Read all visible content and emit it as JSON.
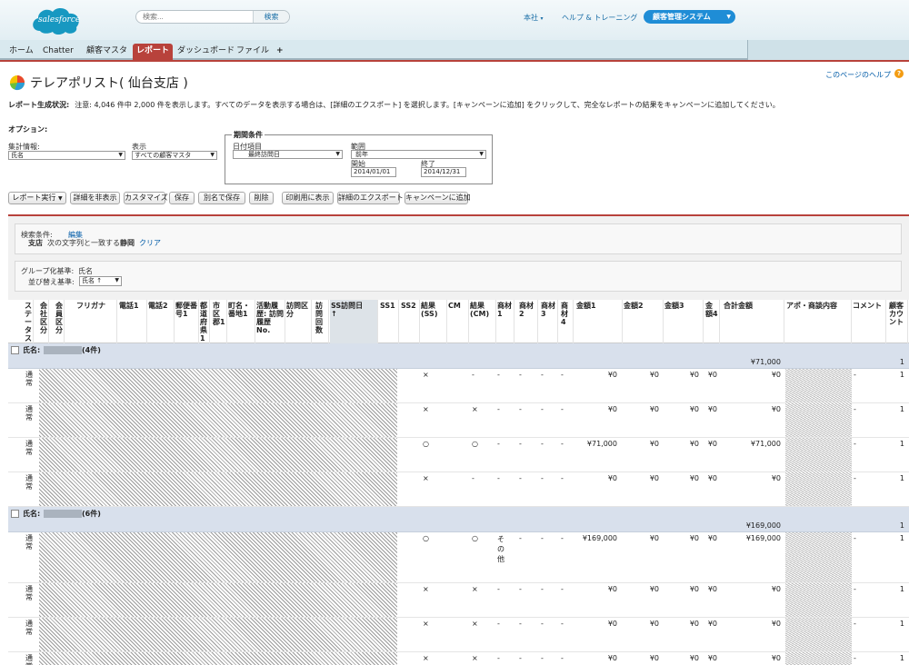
{
  "header": {
    "logo_text": "salesforce",
    "search_placeholder": "検索...",
    "search_button": "検索",
    "links": [
      "本社",
      "ヘルプ & トレーニング"
    ],
    "app_menu": "顧客管理システム"
  },
  "tabs": [
    "ホーム",
    "Chatter",
    "顧客マスタ",
    "レポート",
    "ダッシュボード",
    "ファイル",
    "+"
  ],
  "active_tab": "レポート",
  "page": {
    "title": "テレアポリスト( 仙台支店 )",
    "help_link": "このページのヘルプ",
    "status_label": "レポート生成状況:",
    "status_text": "注意: 4,046 件中 2,000 件を表示します。すべてのデータを表示する場合は、[詳細のエクスポート] を選択します。[キャンペーンに追加] をクリックして、完全なレポートの結果をキャンペーンに追加してください。"
  },
  "options": {
    "label": "オプション:",
    "summary_label": "集計情報:",
    "summary_value": "氏名",
    "show_label": "表示",
    "show_value": "すべての顧客マスタ",
    "period_legend": "期間条件",
    "date_field_label": "日付項目",
    "date_field_value": "最終訪問日",
    "range_label": "範囲",
    "range_value": "前年",
    "start_label": "開始",
    "start_value": "2014/01/01",
    "end_label": "終了",
    "end_value": "2014/12/31"
  },
  "buttons": [
    "レポート実行",
    "詳細を非表示",
    "カスタマイズ",
    "保存",
    "別名で保存",
    "削除",
    "印刷用に表示",
    "詳細のエクスポート",
    "キャンペーンに追加"
  ],
  "filters": {
    "label": "検索条件:",
    "edit": "編集",
    "field": "支店",
    "operator": "次の文字列と一致する",
    "value": "静岡",
    "clear": "クリア"
  },
  "grouping": {
    "label": "グループ化基準:",
    "value": "氏名",
    "sort_label": "並び替え基準:",
    "sort_value": "氏名 ↑"
  },
  "columns": [
    "ステータス",
    "会社区分",
    "会員区分",
    "フリガナ",
    "電話1",
    "電話2",
    "郵便番号1",
    "都道府県1",
    "市区郡1",
    "町名・番地1",
    "活動履歴: 訪問履歴No.",
    "訪問区分",
    "訪問回数",
    "SS訪問日",
    "SS1",
    "SS2",
    "結果(SS)",
    "CM",
    "結果(CM)",
    "商材1",
    "商材2",
    "商材3",
    "商材4",
    "金額1",
    "金額2",
    "金額3",
    "金額4",
    "合計金額",
    "アポ・商談内容",
    "コメント",
    "顧客カウント"
  ],
  "groups": [
    {
      "label": "氏名:",
      "count": "(4件)",
      "total": "¥71,000",
      "customer_count": "1",
      "rows": [
        {
          "status": "通常",
          "ss": "×",
          "cm": "-",
          "m1": "-",
          "m2": "-",
          "m3": "-",
          "m4": "-",
          "a1": "¥0",
          "a2": "¥0",
          "a3": "¥0",
          "a4": "¥0",
          "total": "¥0",
          "comment": "-",
          "count": "1"
        },
        {
          "status": "通常",
          "ss": "×",
          "cm": "×",
          "m1": "-",
          "m2": "-",
          "m3": "-",
          "m4": "-",
          "a1": "¥0",
          "a2": "¥0",
          "a3": "¥0",
          "a4": "¥0",
          "total": "¥0",
          "comment": "-",
          "count": "1"
        },
        {
          "status": "通常",
          "ss": "○",
          "cm": "○",
          "m1": "-",
          "m2": "-",
          "m3": "-",
          "m4": "-",
          "a1": "¥71,000",
          "a2": "¥0",
          "a3": "¥0",
          "a4": "¥0",
          "total": "¥71,000",
          "comment": "-",
          "count": "1"
        },
        {
          "status": "通常",
          "ss": "×",
          "cm": "-",
          "m1": "-",
          "m2": "-",
          "m3": "-",
          "m4": "-",
          "a1": "¥0",
          "a2": "¥0",
          "a3": "¥0",
          "a4": "¥0",
          "total": "¥0",
          "comment": "-",
          "count": "1"
        }
      ]
    },
    {
      "label": "氏名:",
      "count": "(6件)",
      "total": "¥169,000",
      "customer_count": "1",
      "rows": [
        {
          "status": "通常",
          "ss": "○",
          "cm": "○",
          "m1": "その他",
          "m2": "-",
          "m3": "-",
          "m4": "-",
          "a1": "¥169,000",
          "a2": "¥0",
          "a3": "¥0",
          "a4": "¥0",
          "total": "¥169,000",
          "comment": "-",
          "count": "1"
        },
        {
          "status": "通常",
          "ss": "×",
          "cm": "×",
          "m1": "-",
          "m2": "-",
          "m3": "-",
          "m4": "-",
          "a1": "¥0",
          "a2": "¥0",
          "a3": "¥0",
          "a4": "¥0",
          "total": "¥0",
          "comment": "-",
          "count": "1"
        },
        {
          "status": "通常",
          "ss": "×",
          "cm": "×",
          "m1": "-",
          "m2": "-",
          "m3": "-",
          "m4": "-",
          "a1": "¥0",
          "a2": "¥0",
          "a3": "¥0",
          "a4": "¥0",
          "total": "¥0",
          "comment": "-",
          "count": "1"
        },
        {
          "status": "通常",
          "ss": "×",
          "cm": "×",
          "m1": "-",
          "m2": "-",
          "m3": "-",
          "m4": "-",
          "a1": "¥0",
          "a2": "¥0",
          "a3": "¥0",
          "a4": "¥0",
          "total": "¥0",
          "comment": "-",
          "count": "1"
        }
      ]
    }
  ]
}
